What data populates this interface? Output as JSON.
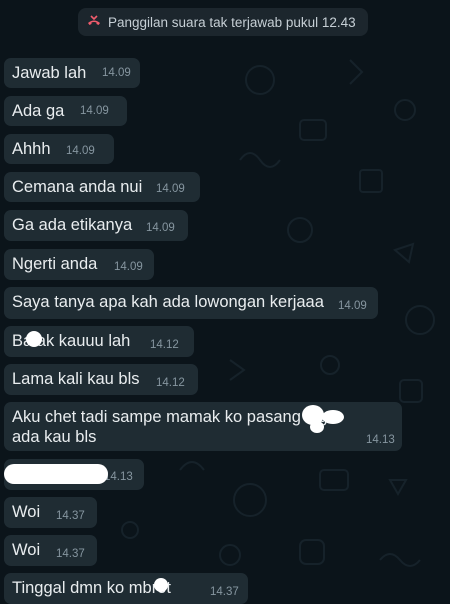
{
  "system": {
    "missed_call_text": "Panggilan suara tak terjawab pukul 12.43",
    "icon": "missed-call-icon"
  },
  "messages": [
    {
      "text": "Jawab lah",
      "time": "14.09"
    },
    {
      "text": "Ada ga",
      "time": "14.09"
    },
    {
      "text": "Ahhh",
      "time": "14.09"
    },
    {
      "text": "Cemana anda nui",
      "time": "14.09"
    },
    {
      "text": "Ga ada etikanya",
      "time": "14.09"
    },
    {
      "text": "Ngerti anda",
      "time": "14.09"
    },
    {
      "text": "Saya tanya apa kah ada lowongan kerjaaa",
      "time": "14.09"
    },
    {
      "text": "Ba  ak kauuu lah",
      "time": "14.12"
    },
    {
      "text": "Lama kali kau bls",
      "time": "14.12"
    },
    {
      "text_line1": "Aku chet tadi sampe mamak ko pasang      x ga",
      "text_line2": "ada kau bls",
      "time": "14.13"
    },
    {
      "text": "",
      "time": "14.13"
    },
    {
      "text": "Woi",
      "time": "14.37"
    },
    {
      "text": "Woi",
      "time": "14.37"
    },
    {
      "text": "Tinggal dmn ko    mbrot",
      "time": "14.37"
    }
  ],
  "colors": {
    "background": "#0b141a",
    "bubble": "#1f2c33",
    "text": "#e9edef",
    "meta": "#8696a0",
    "missed_icon": "#f15c6d"
  }
}
